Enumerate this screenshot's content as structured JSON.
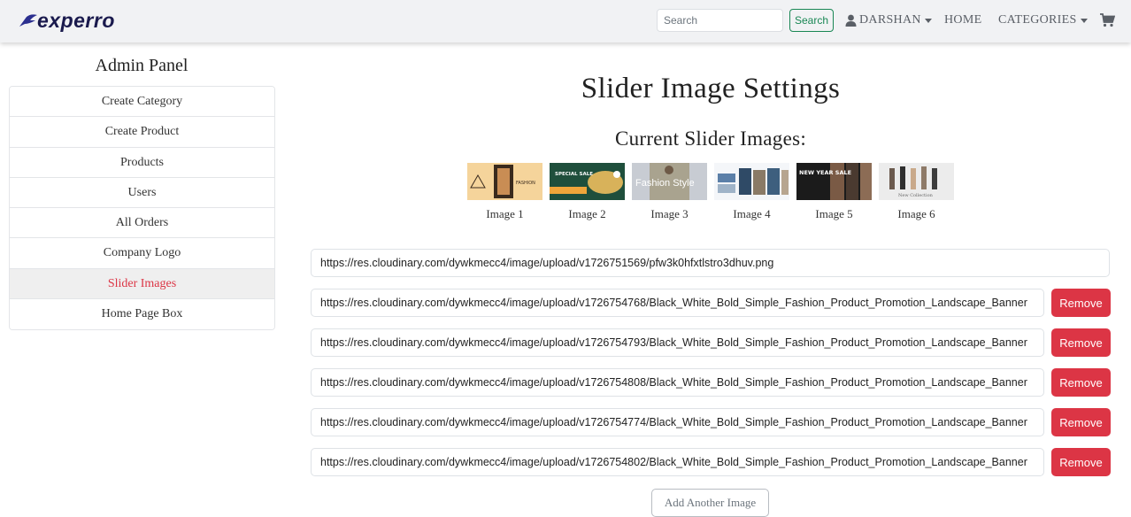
{
  "navbar": {
    "brand": "experro",
    "search_placeholder": "Search",
    "search_button": "Search",
    "user_label": "DARSHAN",
    "home_label": "HOME",
    "categories_label": "CATEGORIES"
  },
  "sidebar": {
    "title": "Admin Panel",
    "items": [
      {
        "label": "Create Category"
      },
      {
        "label": "Create Product"
      },
      {
        "label": "Products"
      },
      {
        "label": "Users"
      },
      {
        "label": "All Orders"
      },
      {
        "label": "Company Logo"
      },
      {
        "label": "Slider Images",
        "active": true
      },
      {
        "label": "Home Page Box"
      }
    ]
  },
  "main": {
    "title": "Slider Image Settings",
    "subtitle": "Current Slider Images:",
    "thumbnails": [
      {
        "label": "Image 1",
        "text": "FASHION"
      },
      {
        "label": "Image 2",
        "text": "SPECIAL SALE"
      },
      {
        "label": "Image 3",
        "text": "Fashion Style"
      },
      {
        "label": "Image 4",
        "text": ""
      },
      {
        "label": "Image 5",
        "text": "NEW YEAR SALE"
      },
      {
        "label": "Image 6",
        "text": "New Collection"
      }
    ],
    "urls": [
      "https://res.cloudinary.com/dywkmecc4/image/upload/v1726751569/pfw3k0hfxtlstro3dhuv.png",
      "https://res.cloudinary.com/dywkmecc4/image/upload/v1726754768/Black_White_Bold_Simple_Fashion_Product_Promotion_Landscape_Banner",
      "https://res.cloudinary.com/dywkmecc4/image/upload/v1726754793/Black_White_Bold_Simple_Fashion_Product_Promotion_Landscape_Banner",
      "https://res.cloudinary.com/dywkmecc4/image/upload/v1726754808/Black_White_Bold_Simple_Fashion_Product_Promotion_Landscape_Banner",
      "https://res.cloudinary.com/dywkmecc4/image/upload/v1726754774/Black_White_Bold_Simple_Fashion_Product_Promotion_Landscape_Banner",
      "https://res.cloudinary.com/dywkmecc4/image/upload/v1726754802/Black_White_Bold_Simple_Fashion_Product_Promotion_Landscape_Banner"
    ],
    "remove_label": "Remove",
    "add_label": "Add Another Image"
  },
  "colors": {
    "danger": "#dc3545",
    "success": "#198754",
    "navbar_bg": "#f1f2f4"
  },
  "icons": [
    "experro-logo-icon",
    "user-icon",
    "caret-down-icon",
    "cart-icon"
  ]
}
